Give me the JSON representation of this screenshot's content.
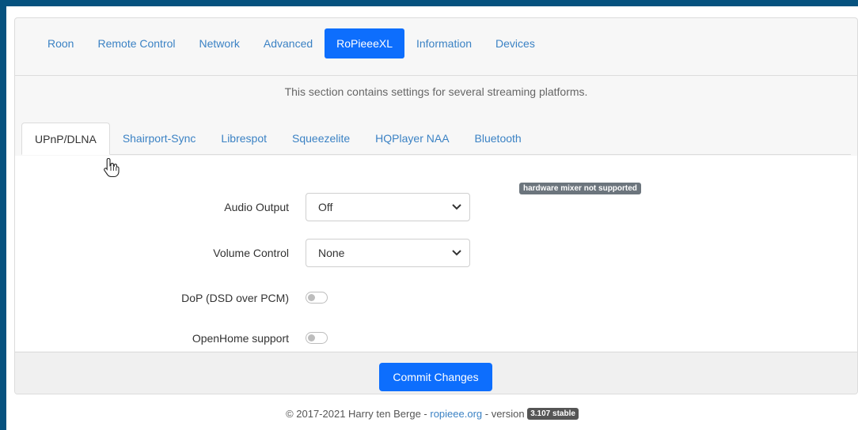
{
  "main_tabs": [
    {
      "label": "Roon"
    },
    {
      "label": "Remote Control"
    },
    {
      "label": "Network"
    },
    {
      "label": "Advanced"
    },
    {
      "label": "RoPieeeXL",
      "active": true
    },
    {
      "label": "Information"
    },
    {
      "label": "Devices"
    }
  ],
  "section_description": "This section contains settings for several streaming platforms.",
  "sub_tabs": [
    {
      "label": "UPnP/DLNA",
      "active": true
    },
    {
      "label": "Shairport-Sync"
    },
    {
      "label": "Librespot"
    },
    {
      "label": "Squeezelite"
    },
    {
      "label": "HQPlayer NAA"
    },
    {
      "label": "Bluetooth"
    }
  ],
  "form": {
    "audio_output": {
      "label": "Audio Output",
      "value": "Off"
    },
    "volume_control": {
      "label": "Volume Control",
      "value": "None"
    },
    "dop": {
      "label": "DoP (DSD over PCM)",
      "checked": false
    },
    "openhome": {
      "label": "OpenHome support",
      "checked": false
    },
    "hardware_badge": "hardware mixer not supported"
  },
  "commit_button": "Commit Changes",
  "footer": {
    "copyright": "© 2017-2021 Harry ten Berge - ",
    "link": "ropieee.org",
    "version_prefix": " - version ",
    "version_badge": "3.107 stable"
  },
  "colors": {
    "accent": "#0d6efd",
    "link": "#3b82c4",
    "outer_background": "#06527f"
  }
}
